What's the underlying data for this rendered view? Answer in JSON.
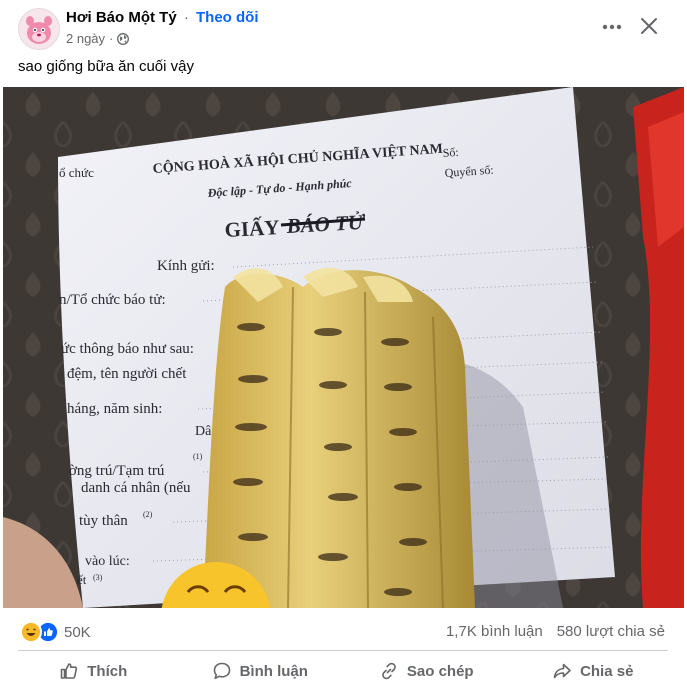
{
  "post": {
    "author": "Hơi Báo Một Tý",
    "separator": "·",
    "follow_label": "Theo dõi",
    "time": "2 ngày",
    "dot": "·",
    "caption": "sao giống bữa ăn cuối vậy"
  },
  "photo": {
    "left_header": "ổ chức",
    "republic": "CỘNG HOÀ XÃ HỘI CHỦ NGHĨA VIỆT NAM",
    "motto": "Độc lập - Tự do - Hạnh phúc",
    "so": "Số:",
    "quyen_so": "Quyển số:",
    "title_giay": "GIẤY",
    "title_struck": "BÁO TỬ",
    "kinh_gui": "Kính gửi:",
    "line1": "n/Tổ chức báo tử:",
    "line2": "ức thông báo như sau:",
    "line3": "đệm, tên người chết",
    "line4": "háng, năm sinh:",
    "line5": "Dân",
    "line6": "ờng trú/Tạm trú",
    "line6_sup": "(1)",
    "line7": "danh cá nhân (nếu",
    "line8": "tùy thân",
    "line8_sup": "(2)",
    "line9": "vào lúc:",
    "line10": "ết",
    "line10_sup": "(3)"
  },
  "stats": {
    "reactions_count": "50K",
    "comments": "1,7K bình luận",
    "shares": "580 lượt chia sẻ"
  },
  "actions": {
    "like": "Thích",
    "comment": "Bình luận",
    "copy": "Sao chép",
    "share": "Chia sẻ"
  },
  "icons": [
    "pink-panther-avatar",
    "globe-icon",
    "more-icon",
    "close-icon",
    "haha-icon",
    "like-icon",
    "thumb-up-icon",
    "comment-bubble-icon",
    "copy-icon",
    "share-icon"
  ]
}
